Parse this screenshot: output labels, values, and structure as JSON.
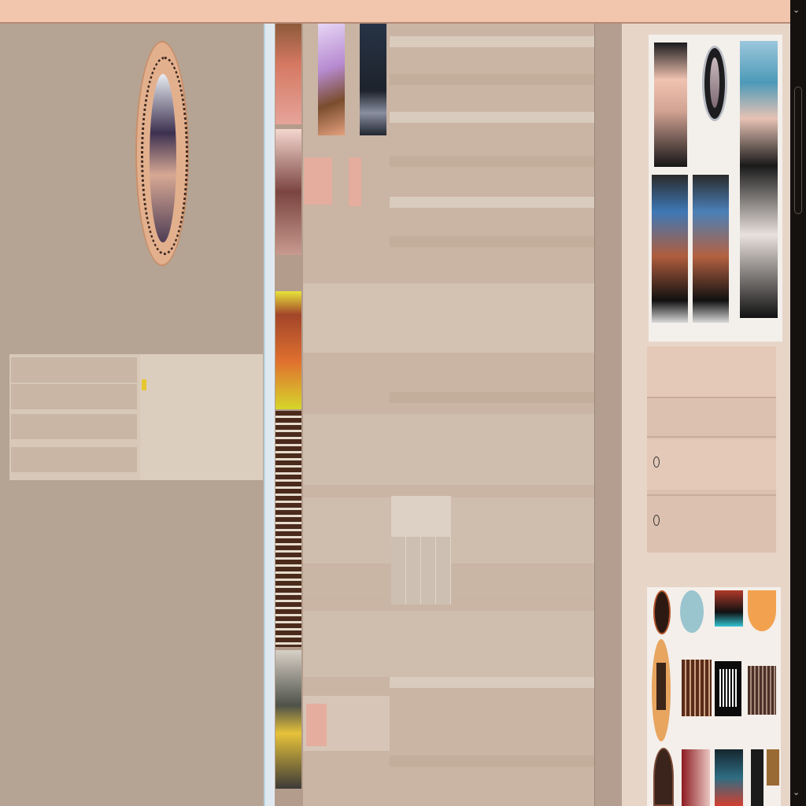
{
  "brand": {
    "name": "",
    "badge": ""
  },
  "left_panel": {
    "profile_lines": [
      "",
      "",
      ""
    ],
    "footnote": "",
    "footnote2": ""
  },
  "center": {
    "tile_label": "",
    "rows": [
      {
        "label": "",
        "cols": [
          "",
          "",
          ""
        ]
      },
      {
        "label": "",
        "cols": [
          "",
          "",
          ""
        ]
      },
      {
        "label": "",
        "cols": [
          "",
          "",
          ""
        ]
      },
      {
        "label": "",
        "cols": [
          "",
          "",
          ""
        ]
      },
      {
        "label": "",
        "cols": [
          "",
          "",
          ""
        ]
      }
    ],
    "popup_tabs": [
      "",
      "",
      ""
    ]
  },
  "right_panel": {
    "menu": [
      {
        "label": "",
        "value": ""
      },
      {
        "label": "",
        "value": ""
      },
      {
        "label": "",
        "value": ""
      },
      {
        "label": "",
        "value": ""
      }
    ]
  },
  "colors": {
    "topbar": "#f2c6ad",
    "panel": "#b5a493",
    "accent_yellow": "#e5c82c",
    "accent_red": "#d4373e",
    "separator": "#dfe9ef"
  },
  "icons": [
    "avatar-emblem",
    "scroll-up-icon",
    "scroll-down-icon",
    "radio-icon"
  ]
}
